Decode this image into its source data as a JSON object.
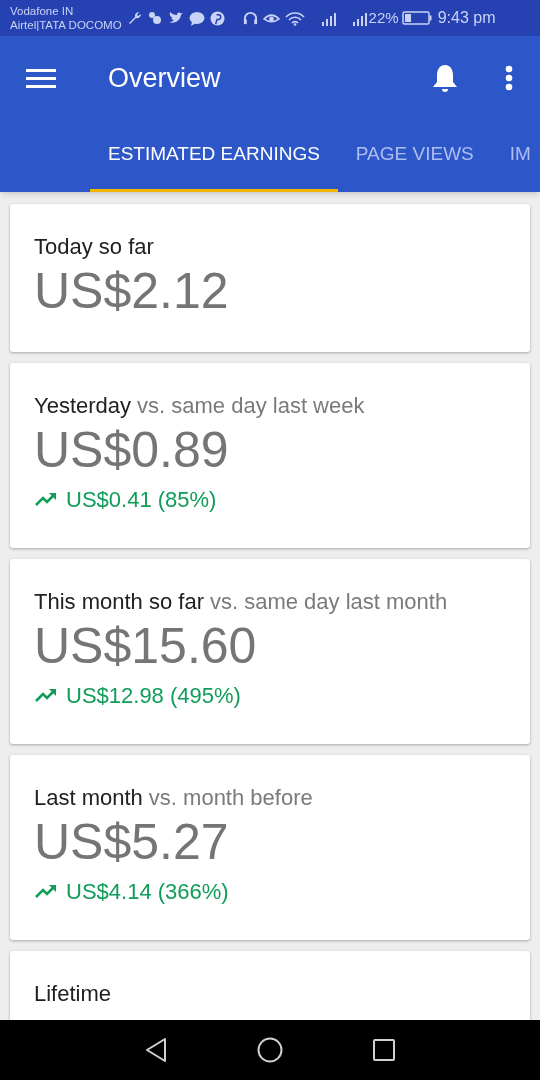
{
  "status_bar": {
    "carriers": [
      "Vodafone IN",
      "Airtel|TATA DOCOMO"
    ],
    "battery": "22%",
    "time": "9:43 pm"
  },
  "toolbar": {
    "title": "Overview"
  },
  "tabs": [
    {
      "label": "ESTIMATED EARNINGS",
      "selected": true
    },
    {
      "label": "PAGE VIEWS",
      "selected": false
    },
    {
      "label": "IM",
      "selected": false
    }
  ],
  "cards": [
    {
      "title": "Today so far",
      "value": "US$2.12"
    },
    {
      "title": "Yesterday",
      "comparison": "vs. same day last week",
      "value": "US$0.89",
      "change": {
        "kind": "up",
        "text": "US$0.41 (85%)"
      }
    },
    {
      "title": "This month so far",
      "comparison": "vs. same day last month",
      "value": "US$15.60",
      "change": {
        "kind": "up",
        "text": "US$12.98 (495%)"
      }
    },
    {
      "title": "Last month",
      "comparison": "vs. month before",
      "value": "US$5.27",
      "change": {
        "kind": "up",
        "text": "US$4.14 (366%)"
      }
    },
    {
      "title": "Lifetime"
    }
  ]
}
